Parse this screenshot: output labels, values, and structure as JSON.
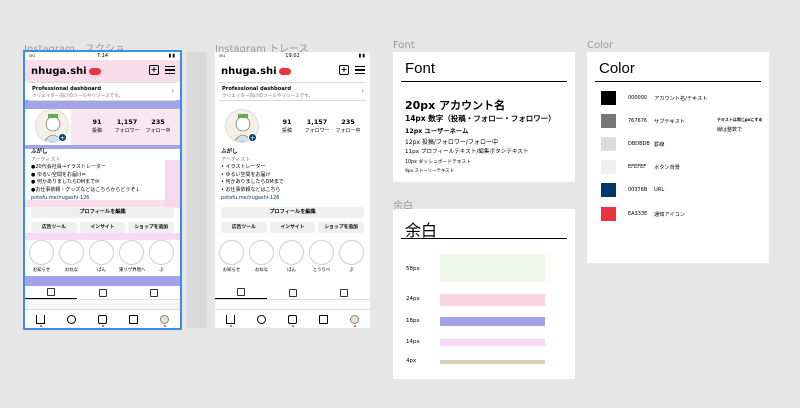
{
  "frames": {
    "instagram_label": "Instagram　スクショ",
    "trace_label": "Instagram トレース",
    "font_label": "Font",
    "spacing_label": "余白",
    "color_label": "Color"
  },
  "phone_a": {
    "status": {
      "carrier": "au",
      "time": "7:14",
      "right": "▮▮"
    },
    "username": "nhuga.shi",
    "dashboard_title": "Professional dashboard",
    "dashboard_sub": "クリエイター向けのツールやリソースです。",
    "stats": [
      {
        "num": "91",
        "label": "投稿"
      },
      {
        "num": "1,157",
        "label": "フォロワー"
      },
      {
        "num": "235",
        "label": "フォロー中"
      }
    ],
    "bio": {
      "name": "ふがし",
      "category": "アーティスト",
      "lines": [
        "●20代会社員→イラストレーター",
        "● ゆるい空間をお届け✏︎",
        "● 何かありましたらDMまで✉︎",
        "●お仕事依頼・グッズなどはこちらからどうぞ↓"
      ],
      "url": "potofu.me/nugashi-126"
    },
    "edit_profile": "プロフィールを編集",
    "buttons": [
      "広告ツール",
      "インサイト",
      "ショップを追加"
    ],
    "highlights": [
      "お知らせ",
      "おねな",
      "ぱん",
      "東リヴ界隈へ",
      "ぷ"
    ]
  },
  "phone_b": {
    "status": {
      "carrier": "au",
      "time": "19:02",
      "right": "▮▮"
    },
    "username": "nhuga.shi",
    "dashboard_title": "Professional dashboard",
    "dashboard_sub": "クリエイター向けのツールやリソースです。",
    "stats": [
      {
        "num": "91",
        "label": "投稿"
      },
      {
        "num": "1,157",
        "label": "フォロワー"
      },
      {
        "num": "235",
        "label": "フォロー中"
      }
    ],
    "bio": {
      "name": "ふがし",
      "category": "アーティスト",
      "lines": [
        "• イラストレーター",
        "• ゆるい空間をお届け",
        "• 何かありましたらDMまで",
        "• お仕事依頼などはこちら"
      ],
      "url": "potofu.me/nugashi-126"
    },
    "edit_profile": "プロフィールを編集",
    "buttons": [
      "広告ツール",
      "インサイト",
      "ショップを追加"
    ],
    "highlights": [
      "お知らせ",
      "おねな",
      "ぱん",
      "とうりべ",
      "ぷ"
    ]
  },
  "font_card": {
    "title": "Font",
    "lines": [
      "20px  アカウント名",
      "14px  数字（投稿・フォロー・フォロワー）",
      "12px  ユーザーネーム",
      "12px  投稿/フォロワー/フォロー中",
      "11px  プロフィールテキスト/編集ボタンテキスト",
      "10px  ダッシュボードテキスト",
      "9px  ストーリーテキスト"
    ]
  },
  "spacing_card": {
    "title": "余白",
    "rows": [
      {
        "label": "58px",
        "color": "#EEF7E8"
      },
      {
        "label": "24px",
        "color": "#F9D4E2"
      },
      {
        "label": "18px",
        "color": "#A3A3EA"
      },
      {
        "label": "14px",
        "color": "#F7D9F4"
      },
      {
        "label": "4px",
        "color": "#D9CEB8"
      }
    ]
  },
  "color_card": {
    "title": "Color",
    "note_1": "テキストは同じpxにする",
    "note_2": "線は整数で",
    "rows": [
      {
        "code": "000000",
        "desc": "アカウント名/テキスト",
        "hex": "#000000"
      },
      {
        "code": "767676",
        "desc": "サブテキスト",
        "hex": "#767676"
      },
      {
        "code": "DBDBDB",
        "desc": "罫線",
        "hex": "#DBDBDB"
      },
      {
        "code": "EFEFEF",
        "desc": "ボタン背景",
        "hex": "#EFEFEF"
      },
      {
        "code": "00376B",
        "desc": "URL",
        "hex": "#00376B"
      },
      {
        "code": "EA333E",
        "desc": "通知アイコン",
        "hex": "#EA333E"
      }
    ]
  }
}
